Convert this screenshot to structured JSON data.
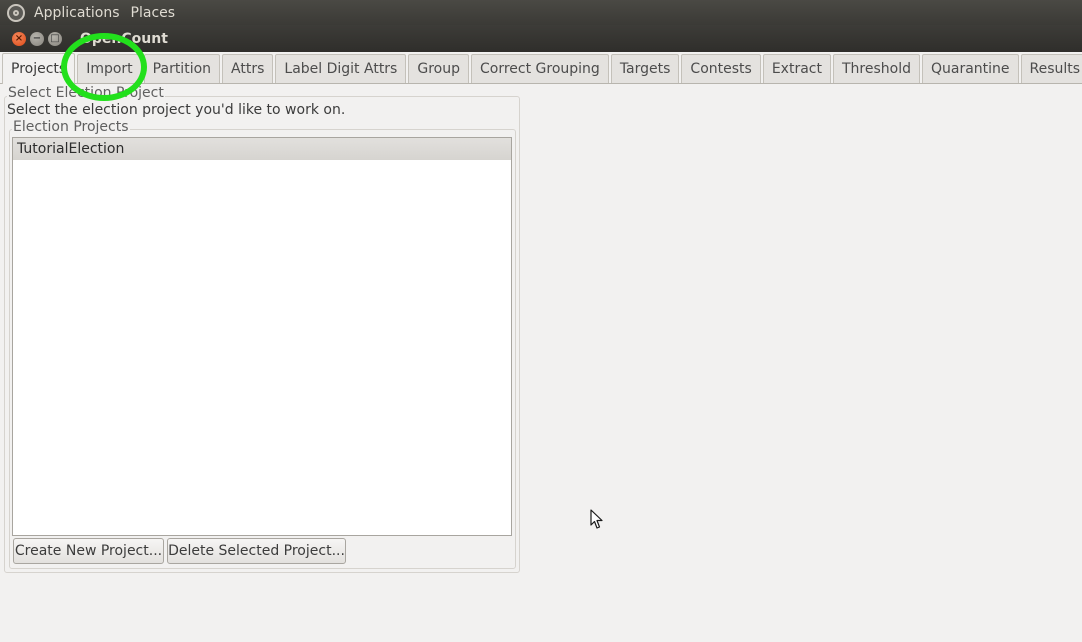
{
  "top_panel": {
    "menus": [
      "Applications",
      "Places"
    ]
  },
  "window": {
    "title": "OpenCount",
    "buttons": {
      "close": "×",
      "minimize": "−",
      "maximize": "□"
    }
  },
  "tabs": [
    {
      "label": "Projects",
      "active": true
    },
    {
      "label": "Import",
      "active": false
    },
    {
      "label": "Partition",
      "active": false
    },
    {
      "label": "Attrs",
      "active": false
    },
    {
      "label": "Label Digit Attrs",
      "active": false
    },
    {
      "label": "Group",
      "active": false
    },
    {
      "label": "Correct Grouping",
      "active": false
    },
    {
      "label": "Targets",
      "active": false
    },
    {
      "label": "Contests",
      "active": false
    },
    {
      "label": "Extract",
      "active": false
    },
    {
      "label": "Threshold",
      "active": false
    },
    {
      "label": "Quarantine",
      "active": false
    },
    {
      "label": "Results",
      "active": false
    }
  ],
  "projects_panel": {
    "group_label": "Select Election Project",
    "instruction": "Select the election project you'd like to work on.",
    "list_group_label": "Election Projects",
    "projects": [
      {
        "name": "TutorialElection",
        "selected": true
      }
    ],
    "create_button": "Create New Project...",
    "delete_button": "Delete Selected Project..."
  },
  "annotation": {
    "highlight_color": "#22e01c",
    "highlighted_tab": "Import"
  }
}
